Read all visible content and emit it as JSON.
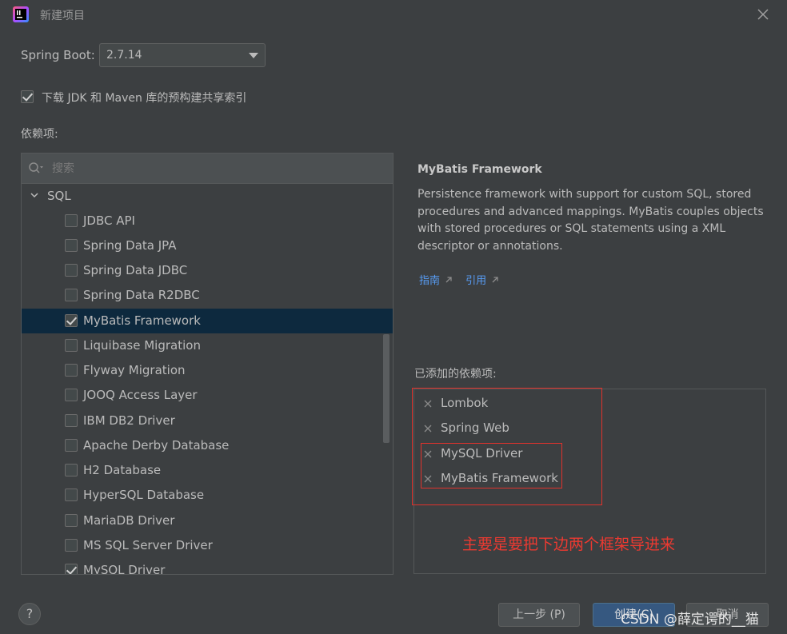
{
  "window": {
    "title": "新建项目"
  },
  "spring_boot": {
    "label": "Spring Boot:",
    "value": "2.7.14"
  },
  "download_option": {
    "label": "下载 JDK 和 Maven 库的预构建共享索引",
    "checked": true
  },
  "dependencies": {
    "label": "依赖项:",
    "search_placeholder": "搜索",
    "group": "SQL",
    "items": [
      {
        "label": "JDBC API",
        "checked": false
      },
      {
        "label": "Spring Data JPA",
        "checked": false
      },
      {
        "label": "Spring Data JDBC",
        "checked": false
      },
      {
        "label": "Spring Data R2DBC",
        "checked": false
      },
      {
        "label": "MyBatis Framework",
        "checked": true,
        "selected": true
      },
      {
        "label": "Liquibase Migration",
        "checked": false
      },
      {
        "label": "Flyway Migration",
        "checked": false
      },
      {
        "label": "JOOQ Access Layer",
        "checked": false
      },
      {
        "label": "IBM DB2 Driver",
        "checked": false
      },
      {
        "label": "Apache Derby Database",
        "checked": false
      },
      {
        "label": "H2 Database",
        "checked": false
      },
      {
        "label": "HyperSQL Database",
        "checked": false
      },
      {
        "label": "MariaDB Driver",
        "checked": false
      },
      {
        "label": "MS SQL Server Driver",
        "checked": false
      },
      {
        "label": "MySQL Driver",
        "checked": true
      }
    ]
  },
  "detail": {
    "title": "MyBatis Framework",
    "description": "Persistence framework with support for custom SQL, stored procedures and advanced mappings. MyBatis couples objects with stored procedures or SQL statements using a XML descriptor or annotations.",
    "links": [
      "指南",
      "引用"
    ]
  },
  "added": {
    "label": "已添加的依赖项:",
    "items": [
      "Lombok",
      "Spring Web",
      "MySQL Driver",
      "MyBatis Framework"
    ]
  },
  "annotation": "主要是要把下边两个框架导进来",
  "buttons": {
    "help": "?",
    "prev": "上一步 (P)",
    "create": "创建(C)",
    "cancel": "取消"
  },
  "watermark": "CSDN @薛定谔的__猫",
  "colors": {
    "background": "#3c3f41",
    "selection": "#0d293e",
    "link": "#589df6",
    "annotation_red": "#e0322c"
  }
}
